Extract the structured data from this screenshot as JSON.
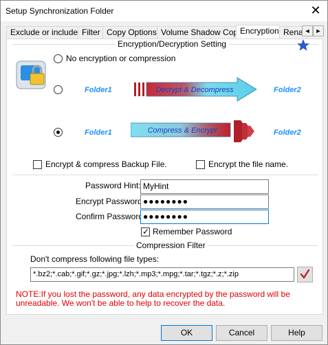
{
  "window": {
    "title": "Setup Synchronization Folder",
    "close_glyph": "✕"
  },
  "tabs": [
    {
      "label": "Exclude or include"
    },
    {
      "label": "Filter"
    },
    {
      "label": "Copy Options"
    },
    {
      "label": "Volume Shadow Copy"
    },
    {
      "label": "Encryption"
    },
    {
      "label": "Renai"
    }
  ],
  "tab_scroll": {
    "left": "◄",
    "right": "►"
  },
  "encryption_group": {
    "title": "Encryption/Decryption Setting",
    "options": [
      {
        "label": "No encryption or compression",
        "checked": false
      },
      {
        "label": "",
        "checked": false,
        "from": "Folder1",
        "arrow": "Decrypt & Decompress",
        "to": "Folder2"
      },
      {
        "label": "",
        "checked": true,
        "from": "Folder1",
        "arrow": "Compress & Encrypt",
        "to": "Folder2"
      }
    ],
    "encrypt_backup_label": "Encrypt & compress Backup File.",
    "encrypt_backup_checked": false,
    "encrypt_filename_label": "Encrypt the file name.",
    "encrypt_filename_checked": false
  },
  "password": {
    "hint_label": "Password Hint:",
    "hint_value": "MyHint",
    "encrypt_label": "Encrypt Password:",
    "encrypt_value": "●●●●●●●●",
    "confirm_label": "Confirm Password:",
    "confirm_value": "●●●●●●●●",
    "remember_label": "Remember Password",
    "remember_checked": true
  },
  "compression_filter": {
    "title": "Compression Filter",
    "description": "Don't compress following file types:",
    "types_value": "*.bz2;*.cab;*.gif;*.gz;*.jpg;*.lzh;*.mp3;*.mpg;*.tar;*.tgz;*.z;*.zip"
  },
  "note": "NOTE:If you lost the password, any data encrypted by the password will be unreadable. We won't be able to help to recover the data.",
  "buttons": {
    "ok": "OK",
    "cancel": "Cancel",
    "help": "Help"
  },
  "colors": {
    "accent": "#0078d7",
    "note": "#e00000",
    "folder_label": "#1e90ff",
    "arrow_fill": "#6fd6ec",
    "arrow_stripe": "#b0202a"
  }
}
